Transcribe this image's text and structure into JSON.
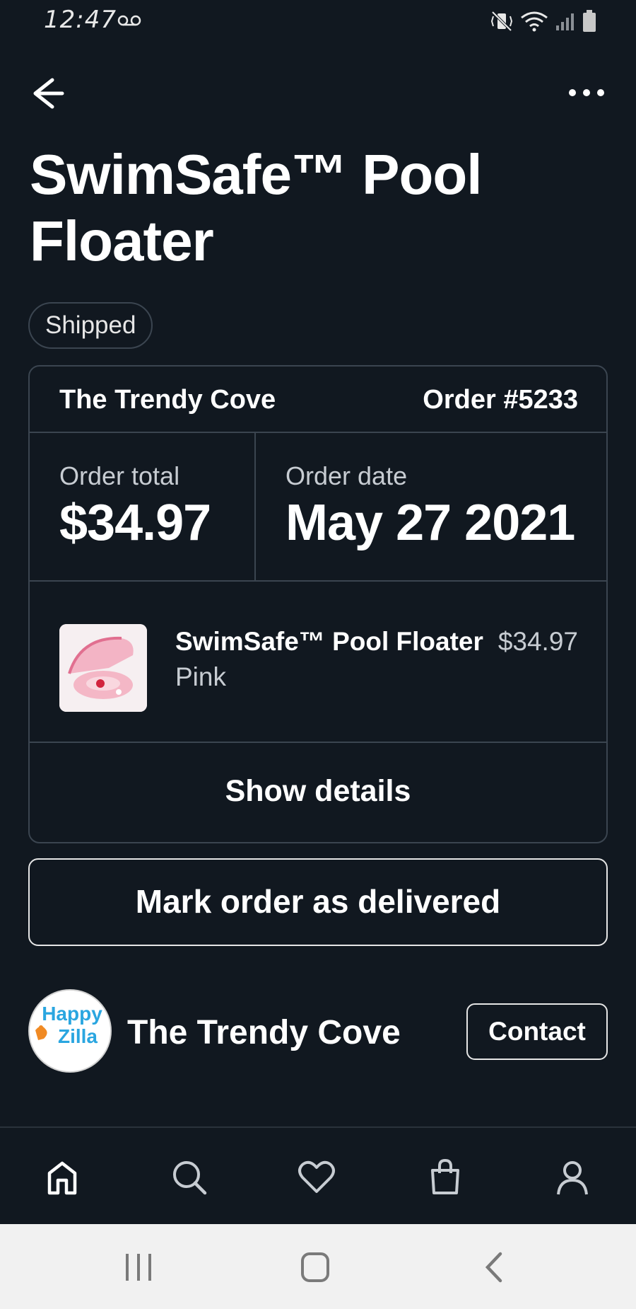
{
  "status_bar": {
    "time": "12:47",
    "icons": [
      "voicemail-icon",
      "mute-vibrate-icon",
      "wifi-icon",
      "signal-icon",
      "battery-icon"
    ]
  },
  "top_nav": {
    "icons": [
      "back-arrow-icon",
      "more-options-icon"
    ]
  },
  "product": {
    "title": "SwimSafe™ Pool Floater",
    "status": "Shipped"
  },
  "order": {
    "store": "The Trendy Cove",
    "number": "Order #5233",
    "total_label": "Order total",
    "total_value": "$34.97",
    "date_label": "Order date",
    "date_value": "May 27 2021",
    "item": {
      "name": "SwimSafe™ Pool Floater",
      "price": "$34.97",
      "variant": "Pink",
      "thumbnail_icon": "pink-pool-floater-image"
    },
    "details_label": "Show details"
  },
  "actions": {
    "mark_delivered": "Mark order as delivered"
  },
  "seller": {
    "name": "The Trendy Cove",
    "logo_text_1": "Happy",
    "logo_text_2": "Zilla",
    "contact_label": "Contact"
  },
  "bottom_nav": {
    "tabs": [
      "home-icon",
      "search-icon",
      "heart-icon",
      "shopping-bag-icon",
      "profile-icon"
    ],
    "active_tab": "home-icon"
  },
  "system_nav": {
    "buttons": [
      "recent-apps-icon",
      "home-button-icon",
      "back-chevron-icon"
    ]
  },
  "colors": {
    "background": "#111820",
    "border": "#3b4550",
    "text": "#ffffff",
    "muted_text": "#c7ccd2",
    "system_bar": "#f1f1f1"
  }
}
